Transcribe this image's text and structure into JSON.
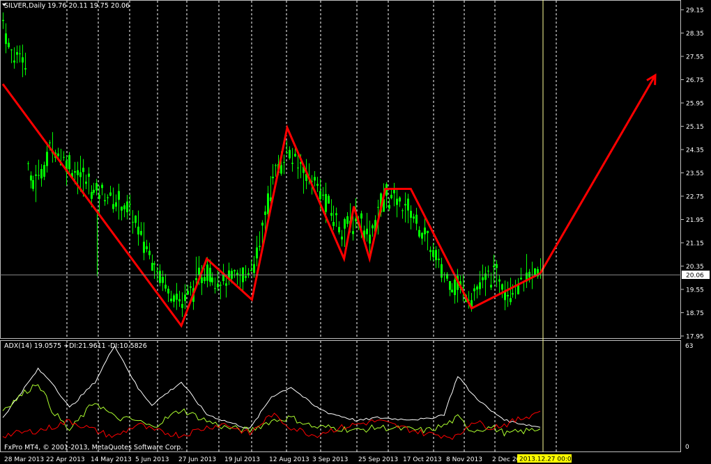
{
  "price_panel": {
    "symbol_info": "SILVER,Daily  19.76 20.11 19.75 20.06",
    "current_price_label": "20.06",
    "axis_labels": [
      "29.15",
      "28.35",
      "27.55",
      "26.75",
      "25.95",
      "25.15",
      "24.35",
      "23.55",
      "22.75",
      "21.95",
      "21.15",
      "20.35",
      "19.55",
      "18.75",
      "17.95"
    ]
  },
  "indicator_panel": {
    "info": "ADX(14) 19.0575 +DI:21.9611 -DI:10.5826",
    "axis_max": "63",
    "axis_min": "0"
  },
  "footer": {
    "copyright": "FxPro MT4, © 2001-2013, MetaQuotes Software Corp.",
    "cursor_date": "2013.12.27 00:00"
  },
  "time_axis": [
    "28 Mar 2013",
    "22 Apr 2013",
    "14 May 2013",
    "5 Jun 2013",
    "27 Jun 2013",
    "19 Jul 2013",
    "12 Aug 2013",
    "3 Sep 2013",
    "25 Sep 2013",
    "17 Oct 2013",
    "8 Nov 2013",
    "2 Dec 2013"
  ],
  "colors": {
    "background": "#000000",
    "candles": "#00ff00",
    "zigzag": "#ff0000",
    "arrow": "#ff0000",
    "grid": "#ffffff",
    "adx": "#ffffff",
    "plus_di": "#adff2f",
    "minus_di": "#ff0000",
    "cursor_line": "#ffff99",
    "cursor_label_bg": "#ffff00"
  },
  "chart_data": {
    "type": "line",
    "zigzag": {
      "x": [
        "2013-03-28",
        "2013-06-27",
        "2013-07-10",
        "2013-08-02",
        "2013-08-20",
        "2013-09-18",
        "2013-09-23",
        "2013-10-01",
        "2013-10-09",
        "2013-10-22",
        "2013-11-22",
        "2013-12-27"
      ],
      "y": [
        26.6,
        18.3,
        20.6,
        19.2,
        25.1,
        20.6,
        22.4,
        20.6,
        23.0,
        23.0,
        18.9,
        20.1
      ]
    },
    "price_path": {
      "x": [
        "2013-03-28",
        "2013-04-01",
        "2013-04-08",
        "2013-04-10",
        "2013-04-16",
        "2013-04-22",
        "2013-05-01",
        "2013-05-14",
        "2013-05-20",
        "2013-06-01",
        "2013-06-05",
        "2013-06-18",
        "2013-06-27",
        "2013-07-10",
        "2013-07-17",
        "2013-07-28",
        "2013-08-05",
        "2013-08-12",
        "2013-08-20",
        "2013-09-03",
        "2013-09-17",
        "2013-09-25",
        "2013-10-01",
        "2013-10-09",
        "2013-10-22",
        "2013-11-08",
        "2013-11-22",
        "2013-12-02",
        "2013-12-10",
        "2013-12-27"
      ],
      "y": [
        28.8,
        27.5,
        27.8,
        23.0,
        23.5,
        24.5,
        23.8,
        22.9,
        22.8,
        22.2,
        21.6,
        19.8,
        19.1,
        20.3,
        19.8,
        19.9,
        20.8,
        23.3,
        24.3,
        23.2,
        21.6,
        22.0,
        21.4,
        22.8,
        22.2,
        20.0,
        19.3,
        20.1,
        19.6,
        20.1
      ]
    },
    "forecast_arrow": {
      "x": [
        "2013-12-27",
        "2014-01-15"
      ],
      "y": [
        20.1,
        26.9
      ]
    },
    "ylim": [
      17.95,
      29.15
    ],
    "indicators": {
      "x": [
        "2013-03-28",
        "2013-04-15",
        "2013-04-22",
        "2013-05-01",
        "2013-05-14",
        "2013-05-24",
        "2013-06-05",
        "2013-06-12",
        "2013-06-27",
        "2013-07-10",
        "2013-07-19",
        "2013-08-01",
        "2013-08-12",
        "2013-08-22",
        "2013-09-03",
        "2013-09-10",
        "2013-09-25",
        "2013-10-05",
        "2013-10-17",
        "2013-10-30",
        "2013-11-08",
        "2013-11-15",
        "2013-11-22",
        "2013-12-02",
        "2013-12-10",
        "2013-12-27"
      ],
      "series": [
        {
          "values": [
            18,
            48,
            40,
            24,
            40,
            63,
            36,
            26,
            40,
            20,
            16,
            11,
            31,
            37,
            25,
            21,
            16,
            18,
            17,
            17,
            20,
            44,
            33,
            22,
            16,
            12
          ]
        },
        {
          "values": [
            23,
            40,
            23,
            10,
            28,
            18,
            16,
            12,
            23,
            16,
            12,
            10,
            16,
            18,
            12,
            12,
            10,
            12,
            11,
            10,
            13,
            18,
            10,
            12,
            8,
            11
          ]
        },
        {
          "values": [
            7,
            10,
            12,
            16,
            10,
            6,
            14,
            10,
            7,
            12,
            14,
            8,
            20,
            12,
            7,
            10,
            14,
            16,
            12,
            8,
            7,
            6,
            16,
            12,
            14,
            22
          ]
        }
      ],
      "ylim": [
        0,
        63
      ]
    }
  }
}
